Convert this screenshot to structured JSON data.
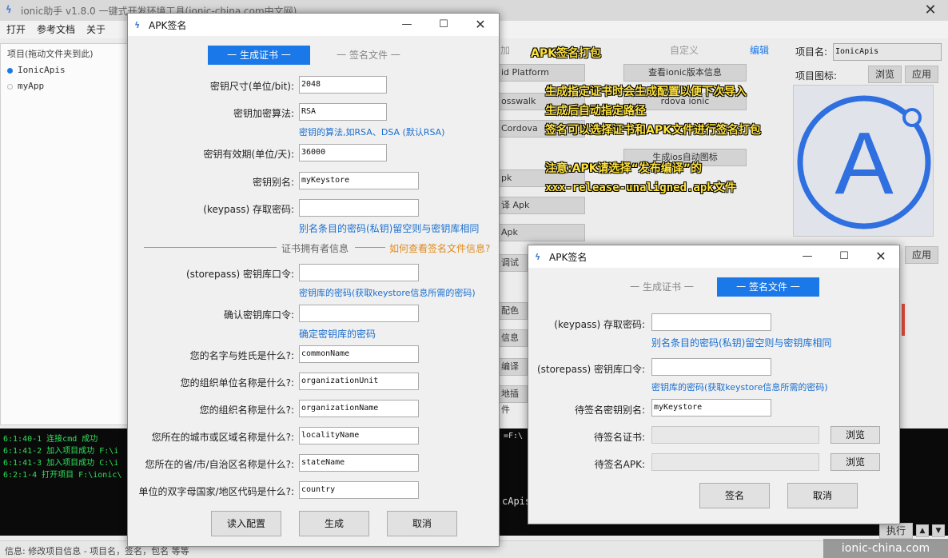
{
  "main": {
    "title": "ionic助手 v1.8.0 一键式开发环境工具(ionic-china.com中文网)",
    "menu": [
      "打开",
      "参考文档",
      "关于"
    ],
    "project_panel": {
      "header": "项目(拖动文件夹到此)",
      "items": [
        "IonicApis",
        "myApp"
      ]
    },
    "tabs_partial": [
      "加",
      "自定义",
      "编辑"
    ],
    "project_name_label": "项目名:",
    "project_name_value": "IonicApis",
    "project_icon_label": "项目图标:",
    "browse_label": "浏览",
    "apply_label": "应用",
    "buttons_partial": [
      "id Platform",
      "查看ionic版本信息",
      "osswalk",
      "rdova ionic",
      "Cordova",
      "生成ios自动图标",
      "pk",
      "译 Apk",
      "Apk",
      "调试",
      "配色",
      "信息",
      "编译",
      "地插件"
    ],
    "console": [
      "6:1:40-1 连接cmd 成功",
      "6:1:41-2 加入项目成功 F:\\i",
      "6:1:41-3 加入项目成功 C:\\i",
      "6:2:1-4 打开项目 F:\\ionic\\"
    ],
    "console_right": "=F:\\",
    "console_right2": "cApis",
    "execute_label": "执行",
    "status": "信息:  修改项目信息 - 项目名，签名，包名 等等",
    "watermark": "ionic-china.com"
  },
  "annotations": [
    "APK签名打包",
    "生成指定证书时会生成配置以便下次导入",
    "生成后自动指定路径",
    "签名可以选择证书和APK文件进行签名打包",
    "注意:APK请选择“发布编译”的",
    "xxx-release-unaligned.apk文件"
  ],
  "dialog_left": {
    "title": "APK签名",
    "tab_generate": "一 生成证书 一",
    "tab_sign": "一 签名文件 一",
    "fields": {
      "key_size_label": "密钥尺寸(单位/bit):",
      "key_size_value": "2048",
      "algorithm_label": "密钥加密算法:",
      "algorithm_value": "RSA",
      "algorithm_hint": "密钥的算法,如RSA、DSA (默认RSA)",
      "validity_label": "密钥有效期(单位/天):",
      "validity_value": "36000",
      "alias_label": "密钥别名:",
      "alias_value": "myKeystore",
      "keypass_label": "(keypass) 存取密码:",
      "keypass_value": "",
      "keypass_hint": "别名条目的密码(私钥)留空则与密钥库相同",
      "section_label": "证书拥有者信息",
      "section_link": "如何查看签名文件信息?",
      "storepass_label": "(storepass) 密钥库口令:",
      "storepass_value": "",
      "storepass_hint": "密钥库的密码(获取keystore信息所需的密码)",
      "confirm_label": "确认密钥库口令:",
      "confirm_value": "",
      "confirm_hint": "确定密钥库的密码",
      "cn_label": "您的名字与姓氏是什么?:",
      "cn_value": "commonName",
      "ou_label": "您的组织单位名称是什么?:",
      "ou_value": "organizationUnit",
      "o_label": "您的组织名称是什么?:",
      "o_value": "organizationName",
      "l_label": "您所在的城市或区域名称是什么?:",
      "l_value": "localityName",
      "st_label": "您所在的省/市/自治区名称是什么?:",
      "st_value": "stateName",
      "c_label": "单位的双字母国家/地区代码是什么?:",
      "c_value": "country"
    },
    "buttons": {
      "load": "读入配置",
      "generate": "生成",
      "cancel": "取消"
    }
  },
  "dialog_right": {
    "title": "APK签名",
    "tab_generate": "一 生成证书 一",
    "tab_sign": "一 签名文件 一",
    "fields": {
      "keypass_label": "(keypass) 存取密码:",
      "keypass_value": "",
      "keypass_hint": "别名条目的密码(私钥)留空则与密钥库相同",
      "storepass_label": "(storepass) 密钥库口令:",
      "storepass_value": "",
      "storepass_hint": "密钥库的密码(获取keystore信息所需的密码)",
      "alias_label": "待签名密钥别名:",
      "alias_value": "myKeystore",
      "cert_label": "待签名证书:",
      "cert_value": "",
      "apk_label": "待签名APK:",
      "apk_value": ""
    },
    "browse_label": "浏览",
    "buttons": {
      "sign": "签名",
      "cancel": "取消"
    }
  },
  "colors": {
    "accent": "#1a78e8",
    "hint": "#1a6fd0",
    "link": "#e08a1a",
    "annotation": "#ffe33a",
    "console_text": "#2ee05a"
  }
}
